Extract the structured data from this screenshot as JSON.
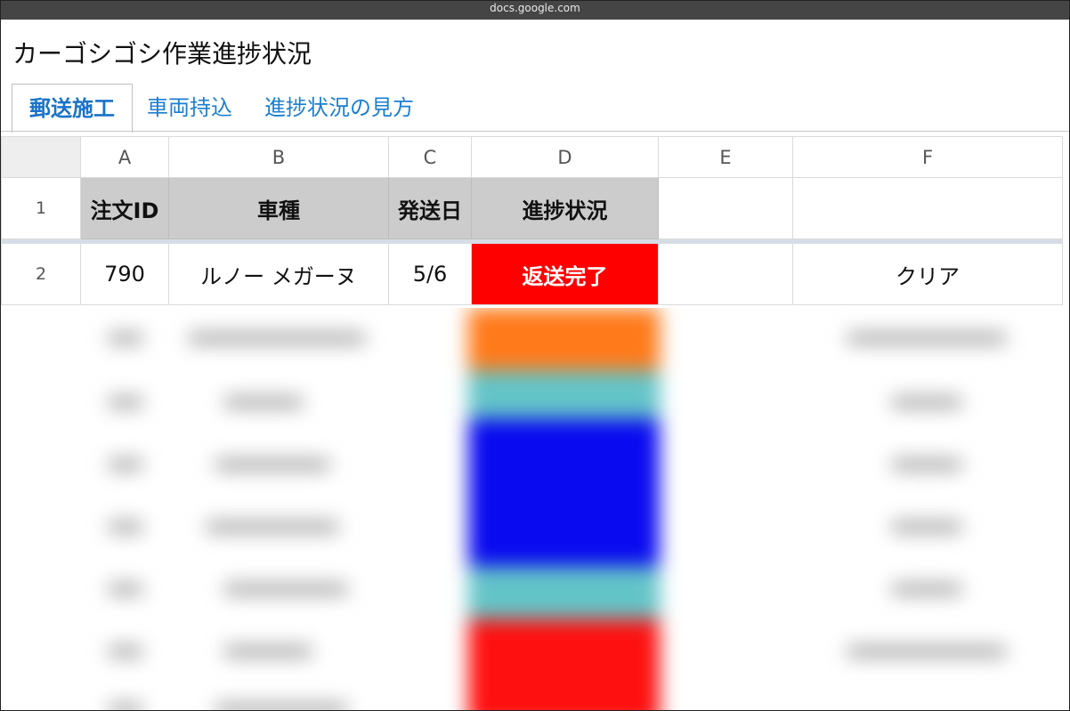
{
  "browser": {
    "url": "docs.google.com"
  },
  "document": {
    "title": "カーゴシゴシ作業進捗状況"
  },
  "tabs": [
    {
      "label": "郵送施工",
      "active": true
    },
    {
      "label": "車両持込",
      "active": false
    },
    {
      "label": "進捗状況の見方",
      "active": false
    }
  ],
  "sheet": {
    "column_headers": [
      "A",
      "B",
      "C",
      "D",
      "E",
      "F"
    ],
    "row_numbers": [
      "1",
      "2"
    ],
    "header_row": [
      "注文ID",
      "車種",
      "発送日",
      "進捗状況",
      "",
      ""
    ],
    "data_row": {
      "order_id": "790",
      "car_model": "ルノー メガーヌ",
      "ship_date": "5/6",
      "status": "返送完了",
      "col_e": "",
      "col_f": "クリア"
    },
    "status_color": "#ff0000",
    "header_bg": "#cccccc",
    "blurred_status_colors": [
      "#ff7a1a",
      "#63c4c8",
      "#0a0af0",
      "#63c4c8",
      "#ff1010"
    ]
  }
}
